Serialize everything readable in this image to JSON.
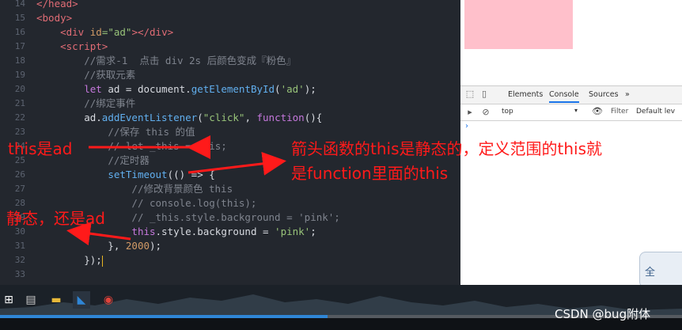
{
  "editor": {
    "lines": [
      {
        "n": "14",
        "tokens": [
          {
            "t": "</head>",
            "c": "tag"
          }
        ]
      },
      {
        "n": "15",
        "tokens": [
          {
            "t": "<body>",
            "c": "tag"
          }
        ]
      },
      {
        "n": "16",
        "tokens": [
          {
            "t": "    "
          },
          {
            "t": "<div ",
            "c": "tag"
          },
          {
            "t": "id",
            "c": "attr"
          },
          {
            "t": "=\"ad\"",
            "c": "str"
          },
          {
            "t": "></div>",
            "c": "tag"
          }
        ]
      },
      {
        "n": "17",
        "tokens": [
          {
            "t": "    "
          },
          {
            "t": "<script>",
            "c": "tag"
          }
        ]
      },
      {
        "n": "18",
        "tokens": [
          {
            "t": "        "
          },
          {
            "t": "//需求-1  点击 div 2s 后颜色变成『粉色』",
            "c": "cm"
          }
        ]
      },
      {
        "n": "19",
        "tokens": [
          {
            "t": "        "
          },
          {
            "t": "//获取元素",
            "c": "cm"
          }
        ]
      },
      {
        "n": "20",
        "tokens": [
          {
            "t": "        "
          },
          {
            "t": "let",
            "c": "kw"
          },
          {
            "t": " ad = document."
          },
          {
            "t": "getElementById",
            "c": "fn"
          },
          {
            "t": "("
          },
          {
            "t": "'ad'",
            "c": "str"
          },
          {
            "t": ");"
          }
        ]
      },
      {
        "n": "21",
        "tokens": [
          {
            "t": "        "
          },
          {
            "t": "//绑定事件",
            "c": "cm"
          }
        ]
      },
      {
        "n": "22",
        "tokens": [
          {
            "t": "        "
          },
          {
            "t": "ad."
          },
          {
            "t": "addEventListener",
            "c": "fn"
          },
          {
            "t": "("
          },
          {
            "t": "\"click\"",
            "c": "str"
          },
          {
            "t": ", "
          },
          {
            "t": "function",
            "c": "kw"
          },
          {
            "t": "(){"
          }
        ]
      },
      {
        "n": "23",
        "tokens": [
          {
            "t": "            "
          },
          {
            "t": "//保存 this 的值",
            "c": "cm"
          }
        ]
      },
      {
        "n": "24",
        "tokens": [
          {
            "t": "            "
          },
          {
            "t": "// let _this = this;",
            "c": "cm"
          }
        ]
      },
      {
        "n": "25",
        "tokens": [
          {
            "t": "            "
          },
          {
            "t": "//定时器",
            "c": "cm"
          }
        ]
      },
      {
        "n": "26",
        "tokens": [
          {
            "t": "            "
          },
          {
            "t": "setTimeout",
            "c": "fn"
          },
          {
            "t": "(() => {"
          }
        ]
      },
      {
        "n": "27",
        "tokens": [
          {
            "t": "                "
          },
          {
            "t": "//修改背景颜色 this",
            "c": "cm"
          }
        ]
      },
      {
        "n": "28",
        "tokens": [
          {
            "t": "                "
          },
          {
            "t": "// console.log(this);",
            "c": "cm"
          }
        ]
      },
      {
        "n": "29",
        "tokens": [
          {
            "t": "                "
          },
          {
            "t": "// _this.style.background = 'pink';",
            "c": "cm"
          }
        ]
      },
      {
        "n": "30",
        "tokens": [
          {
            "t": "                "
          },
          {
            "t": "this",
            "c": "kw"
          },
          {
            "t": ".style.background = "
          },
          {
            "t": "'pink'",
            "c": "str"
          },
          {
            "t": ";"
          }
        ]
      },
      {
        "n": "31",
        "tokens": [
          {
            "t": "            }, "
          },
          {
            "t": "2000",
            "c": "num"
          },
          {
            "t": ");"
          }
        ]
      },
      {
        "n": "32",
        "tokens": [
          {
            "t": "        });"
          }
        ]
      },
      {
        "n": "33",
        "tokens": []
      }
    ]
  },
  "annotations": {
    "this_is_ad": "this是ad",
    "arrow_note_line1": "箭头函数的this是静态的，定义范围的this就",
    "arrow_note_line2": "是function里面的this",
    "static_still_ad": "静态，还是ad"
  },
  "devtools": {
    "tabs": [
      "Elements",
      "Console",
      "Sources",
      "»"
    ],
    "active_tab": "Console",
    "context": "top",
    "filter_placeholder": "Filter",
    "levels": "Default lev",
    "prompt": "›"
  },
  "widget_text": "全",
  "watermark": "CSDN @bug附体",
  "video_progress": 0.48,
  "colors": {
    "pink_box": "#ffc0cb",
    "annotation": "#ff1a1a",
    "accent": "#2f86d6"
  }
}
